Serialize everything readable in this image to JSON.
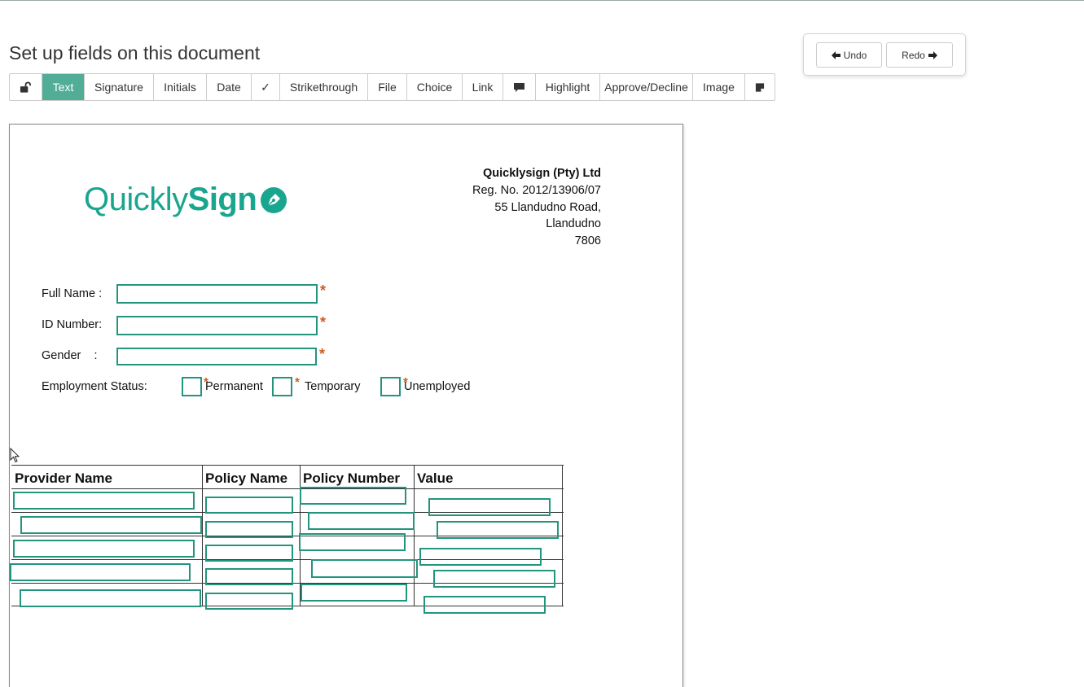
{
  "header": {
    "title": "Set up fields on this document"
  },
  "toolbar": {
    "items": [
      {
        "label": "",
        "icon": "unlock-icon"
      },
      {
        "label": "Text",
        "active": true
      },
      {
        "label": "Signature"
      },
      {
        "label": "Initials"
      },
      {
        "label": "Date"
      },
      {
        "label": "✓"
      },
      {
        "label": "Strikethrough"
      },
      {
        "label": "File"
      },
      {
        "label": "Choice"
      },
      {
        "label": "Link"
      },
      {
        "label": "",
        "icon": "comment-icon"
      },
      {
        "label": "Highlight"
      },
      {
        "label": "Approve/Decline"
      },
      {
        "label": "Image"
      },
      {
        "label": "",
        "icon": "sticky-note-icon"
      }
    ],
    "accent": "#52ad96"
  },
  "history": {
    "undo_label": "Undo",
    "redo_label": "Redo"
  },
  "document": {
    "logo": {
      "light": "Quickly",
      "bold": "Sign",
      "color": "#1aa58e"
    },
    "company": {
      "name": "Quicklysign (Pty) Ltd",
      "reg": "Reg. No. 2012/13906/07",
      "address1": "55 Llandudno Road,",
      "address2": "Llandudno",
      "postcode": "7806"
    },
    "form": {
      "full_name_label": "Full Name :",
      "id_number_label": "ID Number:",
      "gender_label": "Gender    :",
      "employment_label": "Employment Status:",
      "required_marker": "*",
      "employment_options": [
        "Permanent",
        "Temporary",
        "Unemployed"
      ]
    },
    "table": {
      "headers": [
        "Provider Name",
        "Policy Name",
        "Policy Number",
        "Value"
      ]
    },
    "field_color": "#23957e"
  }
}
